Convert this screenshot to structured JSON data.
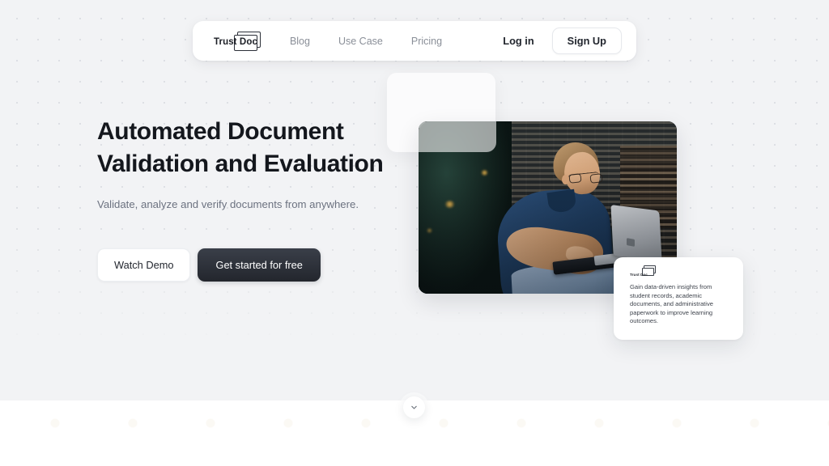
{
  "brand": {
    "name": "Trust Doc",
    "logo_icon": "stacked-document-icon"
  },
  "nav": {
    "links": [
      {
        "label": "Blog"
      },
      {
        "label": "Use Case"
      },
      {
        "label": "Pricing"
      }
    ],
    "login_label": "Log in",
    "signup_label": "Sign Up"
  },
  "hero": {
    "headline_line1": "Automated Document",
    "headline_line2": "Validation and Evaluation",
    "subhead": "Validate, analyze and verify documents from anywhere.",
    "secondary_cta": "Watch Demo",
    "primary_cta": "Get started for free"
  },
  "info_card": {
    "brand_name": "Trust Doc",
    "body": "Gain data-driven insights from student records, academic documents, and administrative paperwork to improve learning outcomes."
  },
  "scroll_cue": {
    "icon": "chevron-down-icon"
  },
  "colors": {
    "hero_background": "#f2f3f5",
    "page_background": "#ffffff",
    "heading_text": "#14171d",
    "muted_text": "#6c7280",
    "nav_link": "#8a8f98",
    "primary_button": "#23262d",
    "card_surface": "#ffffff"
  }
}
